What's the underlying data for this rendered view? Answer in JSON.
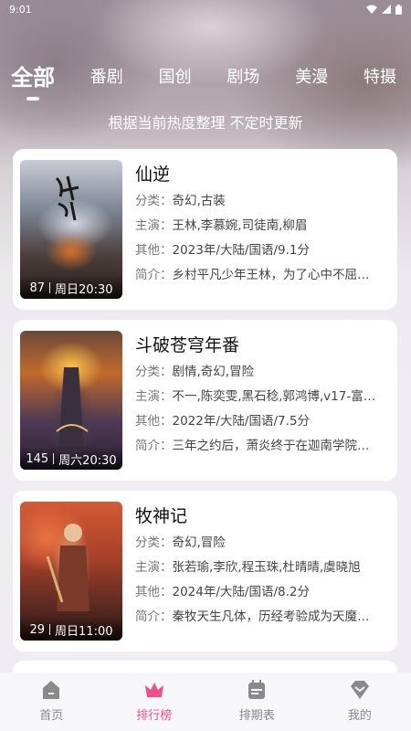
{
  "status": {
    "time": "9:01"
  },
  "tabs": [
    {
      "label": "全部",
      "active": true
    },
    {
      "label": "番剧",
      "active": false
    },
    {
      "label": "国创",
      "active": false
    },
    {
      "label": "剧场",
      "active": false
    },
    {
      "label": "美漫",
      "active": false
    },
    {
      "label": "特摄",
      "active": false
    }
  ],
  "subtitle": "根据当前热度整理 不定时更新",
  "labels": {
    "genre": "分类：",
    "cast": "主演：",
    "other": "其他：",
    "intro": "简介："
  },
  "items": [
    {
      "title": "仙逆",
      "episodes": "87",
      "schedule": "周日20:30",
      "genre": "奇幻,古装",
      "cast": "王林,李慕婉,司徒南,柳眉",
      "other": "2023年/大陆/国语/9.1分",
      "intro": "乡村平凡少年王林，为了心中不屈…"
    },
    {
      "title": "斗破苍穹年番",
      "episodes": "145",
      "schedule": "周六20:30",
      "genre": "剧情,奇幻,冒险",
      "cast": "不一,陈奕雯,黑石稔,郭鸿博,v17-富…",
      "other": "2022年/大陆/国语/7.5分",
      "intro": "三年之约后，萧炎终于在迦南学院…"
    },
    {
      "title": "牧神记",
      "episodes": "29",
      "schedule": "周日11:00",
      "genre": "奇幻,冒险",
      "cast": "张若瑜,李欣,程玉珠,杜晴晴,虞晓旭",
      "other": "2024年/大陆/国语/8.2分",
      "intro": "秦牧天生凡体，历经考验成为天魔…"
    }
  ],
  "nav": [
    {
      "label": "首页",
      "icon": "home-icon",
      "active": false
    },
    {
      "label": "排行榜",
      "icon": "crown-icon",
      "active": true
    },
    {
      "label": "排期表",
      "icon": "calendar-icon",
      "active": false
    },
    {
      "label": "我的",
      "icon": "diamond-icon",
      "active": false
    }
  ],
  "colors": {
    "accent": "#f0508a",
    "inactive": "#8a8a8a"
  }
}
